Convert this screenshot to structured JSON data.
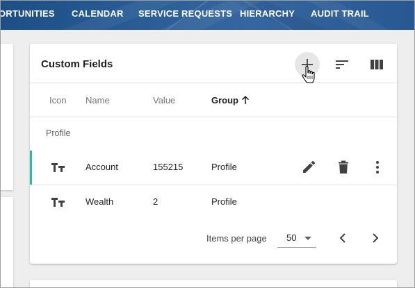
{
  "nav": {
    "items": [
      "ORTUNITIES",
      "CALENDAR",
      "SERVICE REQUESTS",
      "HIERARCHY",
      "AUDIT TRAIL"
    ]
  },
  "card": {
    "title": "Custom Fields",
    "toolbar": {
      "add_icon": "add-icon",
      "sort_icon": "sort-icon",
      "columns_icon": "view-columns-icon"
    }
  },
  "table": {
    "headers": {
      "icon": "Icon",
      "name": "Name",
      "value": "Value",
      "group": "Group"
    },
    "sorted_column": "Group",
    "sort_direction": "ascending",
    "group_label": "Profile",
    "rows": [
      {
        "icon": "text-field-icon",
        "name": "Account",
        "value": "155215",
        "group": "Profile",
        "selected": true
      },
      {
        "icon": "text-field-icon",
        "name": "Wealth",
        "value": "2",
        "group": "Profile",
        "selected": false
      }
    ]
  },
  "pagination": {
    "items_per_page_label": "Items per page",
    "items_per_page_value": "50"
  },
  "colors": {
    "nav_bg": "#2a5d96",
    "selected_row_accent": "#1dbfa5",
    "page_bg": "#eeeeee"
  }
}
